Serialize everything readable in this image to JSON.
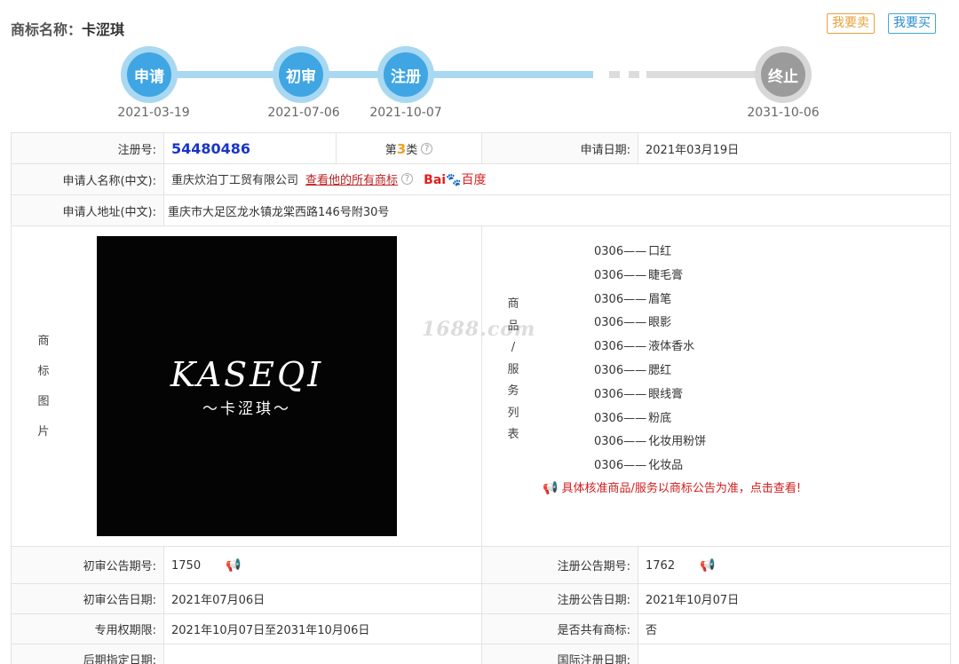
{
  "header": {
    "title_label": "商标名称：",
    "title_value": "卡涩琪",
    "sell_label": "我要卖",
    "buy_label": "我要买"
  },
  "timeline": [
    {
      "label": "申请",
      "date": "2021-03-19",
      "state": "done"
    },
    {
      "label": "初审",
      "date": "2021-07-06",
      "state": "done"
    },
    {
      "label": "注册",
      "date": "2021-10-07",
      "state": "done"
    },
    {
      "label": "终止",
      "date": "2031-10-06",
      "state": "future"
    }
  ],
  "info": {
    "reg_no_label": "注册号:",
    "reg_no": "54480486",
    "class_prefix": "第",
    "class_num": "3",
    "class_suffix": "类",
    "apply_date_label": "申请日期:",
    "apply_date": "2021年03月19日",
    "applicant_label": "申请人名称(中文):",
    "applicant": "重庆炊泊丁工贸有限公司",
    "all_marks_link": "查看他的所有商标",
    "baidu_text": "Bai",
    "baidu_du": "百度",
    "address_label": "申请人地址(中文):",
    "address": "重庆市大足区龙水镇龙棠西路146号附30号",
    "image_label": [
      "商",
      "标",
      "图",
      "片"
    ],
    "logo_main": "KASEQI",
    "logo_sub": "～卡涩琪～",
    "goods_label": [
      "商",
      "品",
      "/",
      "服",
      "务",
      "列",
      "表"
    ],
    "watermark": "1688.com",
    "goods": [
      {
        "code": "0306——",
        "name": "口红"
      },
      {
        "code": "0306——",
        "name": "睫毛膏"
      },
      {
        "code": "0306——",
        "name": "眉笔"
      },
      {
        "code": "0306——",
        "name": "眼影"
      },
      {
        "code": "0306——",
        "name": "液体香水"
      },
      {
        "code": "0306——",
        "name": "腮红"
      },
      {
        "code": "0306——",
        "name": "眼线膏"
      },
      {
        "code": "0306——",
        "name": "粉底"
      },
      {
        "code": "0306——",
        "name": "化妆用粉饼"
      },
      {
        "code": "0306——",
        "name": "化妆品"
      }
    ],
    "goods_notice": "具体核准商品/服务以商标公告为准，点击查看!",
    "prelim_no_label": "初审公告期号:",
    "prelim_no": "1750",
    "reg_pub_no_label": "注册公告期号:",
    "reg_pub_no": "1762",
    "prelim_date_label": "初审公告日期:",
    "prelim_date": "2021年07月06日",
    "reg_pub_date_label": "注册公告日期:",
    "reg_pub_date": "2021年10月07日",
    "term_label": "专用权期限:",
    "term": "2021年10月07日至2031年10月06日",
    "shared_label": "是否共有商标:",
    "shared": "否",
    "later_date_label": "后期指定日期:",
    "intl_date_label": "国际注册日期:"
  },
  "colors": {
    "accent_blue": "#3fa6e3",
    "line_blue": "#a9d8f2",
    "future_gray": "#9b9b9b",
    "reg_no_blue": "#1a35c9",
    "notice_red": "#d21d1d",
    "sell_orange": "#e8a23c"
  }
}
